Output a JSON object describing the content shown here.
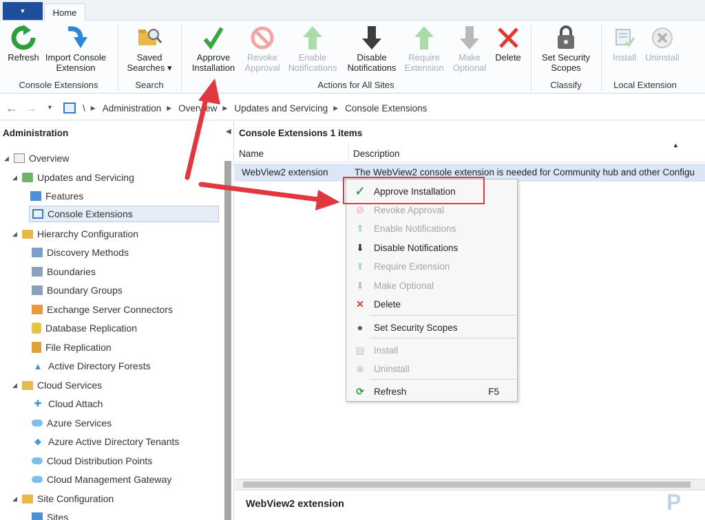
{
  "tabs": {
    "home": "Home"
  },
  "ribbon": {
    "refresh": "Refresh",
    "import_line1": "Import Console",
    "import_line2": "Extension",
    "group_console_extensions": "Console Extensions",
    "saved_line1": "Saved",
    "saved_line2": "Searches ▾",
    "group_search": "Search",
    "approve_line1": "Approve",
    "approve_line2": "Installation",
    "revoke_line1": "Revoke",
    "revoke_line2": "Approval",
    "enable_line1": "Enable",
    "enable_line2": "Notifications",
    "disable_line1": "Disable",
    "disable_line2": "Notifications",
    "require_line1": "Require",
    "require_line2": "Extension",
    "make_line1": "Make",
    "make_line2": "Optional",
    "delete": "Delete",
    "group_actions": "Actions for All Sites",
    "setsec_line1": "Set Security",
    "setsec_line2": "Scopes",
    "group_classify": "Classify",
    "install": "Install",
    "uninstall": "Uninstall",
    "group_local": "Local Extension"
  },
  "breadcrumb": {
    "root": "\\",
    "items": [
      "Administration",
      "Overview",
      "Updates and Servicing",
      "Console Extensions"
    ]
  },
  "nav": {
    "title": "Administration",
    "items": [
      "Overview",
      "Updates and Servicing",
      "Features",
      "Console Extensions",
      "Hierarchy Configuration",
      "Discovery Methods",
      "Boundaries",
      "Boundary Groups",
      "Exchange Server Connectors",
      "Database Replication",
      "File Replication",
      "Active Directory Forests",
      "Cloud Services",
      "Cloud Attach",
      "Azure Services",
      "Azure Active Directory Tenants",
      "Cloud Distribution Points",
      "Cloud Management Gateway",
      "Site Configuration",
      "Sites"
    ]
  },
  "list": {
    "title": "Console Extensions 1 items",
    "col_name": "Name",
    "col_description": "Description",
    "row_name": "WebView2 extension",
    "row_description": "The WebView2 console extension is needed for Community hub and other Configu"
  },
  "detail": {
    "title": "WebView2 extension"
  },
  "menu": {
    "approve": "Approve Installation",
    "revoke": "Revoke Approval",
    "enable": "Enable Notifications",
    "disable": "Disable Notifications",
    "require": "Require Extension",
    "optional": "Make Optional",
    "delete": "Delete",
    "setsec": "Set Security Scopes",
    "install": "Install",
    "uninstall": "Uninstall",
    "refresh": "Refresh",
    "refresh_shortcut": "F5"
  },
  "colors": {
    "accent": "#1f4e9a",
    "highlight": "#e0383e",
    "selection": "#dbe7f6"
  }
}
